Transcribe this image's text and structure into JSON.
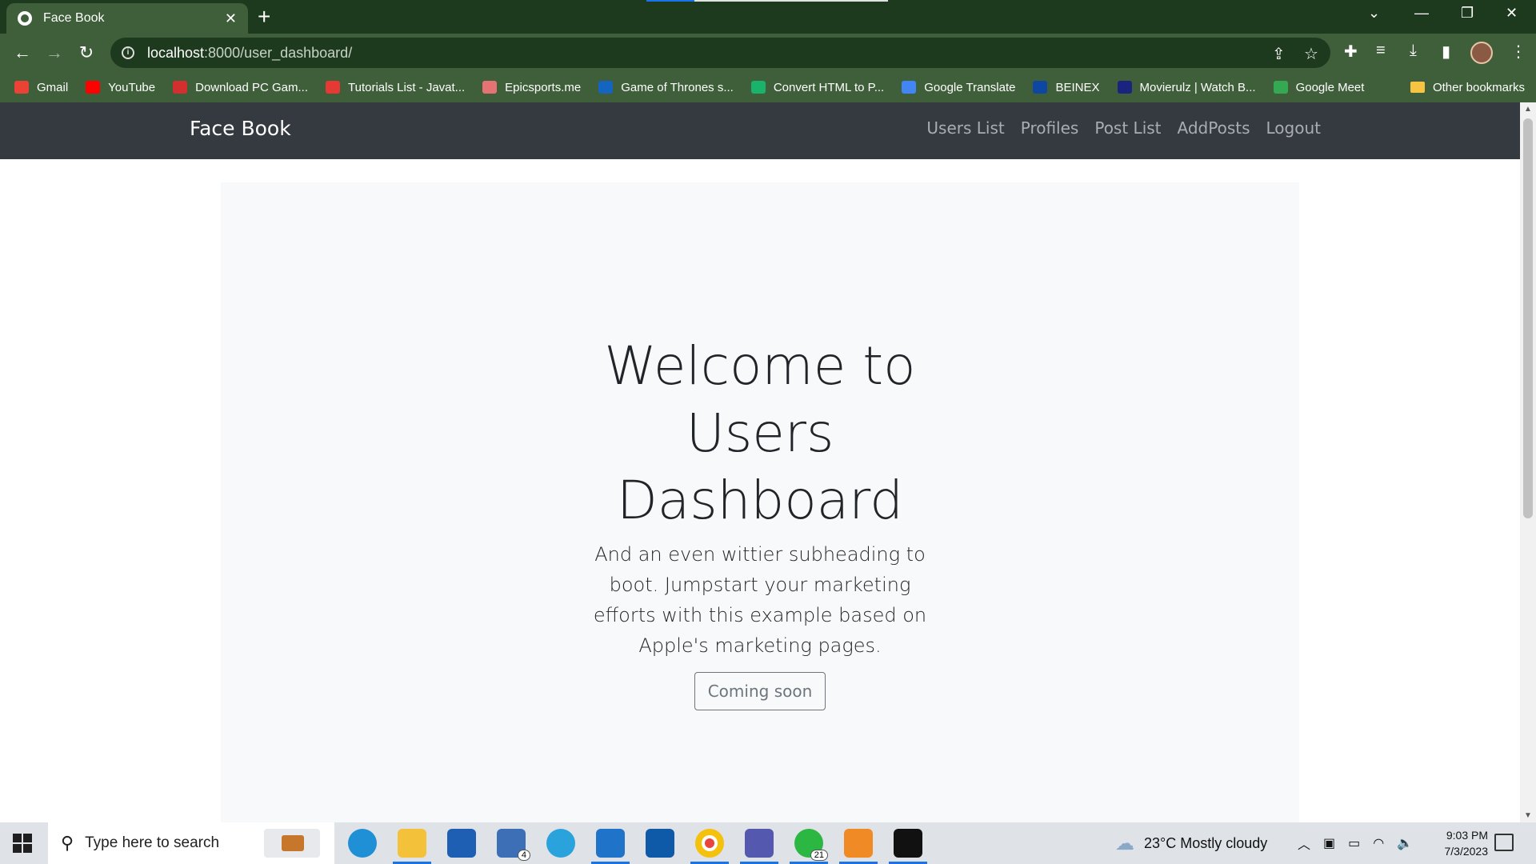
{
  "browser": {
    "tab_title": "Face Book",
    "url_host": "localhost",
    "url_path": ":8000/user_dashboard/",
    "bookmarks": [
      {
        "label": "Gmail",
        "color": "#ea4335"
      },
      {
        "label": "YouTube",
        "color": "#ff0000"
      },
      {
        "label": "Download PC Gam...",
        "color": "#d32f2f"
      },
      {
        "label": "Tutorials List - Javat...",
        "color": "#e53935"
      },
      {
        "label": "Epicsports.me",
        "color": "#e57373"
      },
      {
        "label": "Game of Thrones s...",
        "color": "#1565c0"
      },
      {
        "label": "Convert HTML to P...",
        "color": "#19b36b"
      },
      {
        "label": "Google Translate",
        "color": "#4285f4"
      },
      {
        "label": "BEINEX",
        "color": "#0d47a1"
      },
      {
        "label": "Movierulz | Watch B...",
        "color": "#1a237e"
      },
      {
        "label": "Google Meet",
        "color": "#34a853"
      }
    ],
    "other_bookmarks": "Other bookmarks"
  },
  "site": {
    "brand": "Face Book",
    "nav": [
      "Users List",
      "Profiles",
      "Post List",
      "AddPosts",
      "Logout"
    ]
  },
  "hero": {
    "title_line1": "Welcome to",
    "title_line2": "Users",
    "title_line3": "Dashboard",
    "subheading": "And an even wittier subheading to boot. Jumpstart your marketing efforts with this example based on Apple's marketing pages.",
    "button": "Coming soon"
  },
  "taskbar": {
    "search_placeholder": "Type here to search",
    "mail_badge": "4",
    "whatsapp_badge": "21",
    "weather": "23°C  Mostly cloudy",
    "time": "9:03 PM",
    "date": "7/3/2023"
  }
}
